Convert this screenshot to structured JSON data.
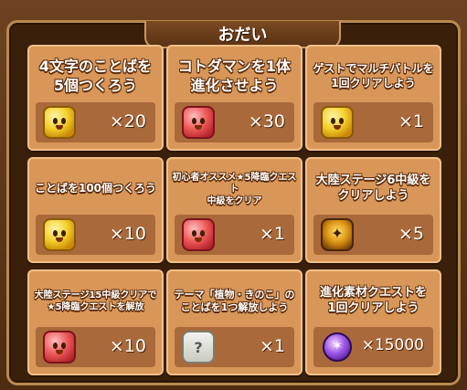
{
  "header": {
    "title": "おだい"
  },
  "quests": [
    {
      "title": "4文字のことばを\n5個つくろう",
      "reward_icon": "yellow-kotodaman-icon",
      "reward_qty": "×20"
    },
    {
      "title": "コトダマンを1体\n進化させよう",
      "reward_icon": "red-kotodaman-icon",
      "reward_qty": "×30"
    },
    {
      "title": "ゲストでマルチバトルを\n1回クリアしよう",
      "reward_icon": "yellow-kotodaman-icon",
      "reward_qty": "×1"
    },
    {
      "title": "ことばを100個つくろう",
      "reward_icon": "yellow-kotodaman-icon",
      "reward_qty": "×10"
    },
    {
      "title": "初心者オススメ★5降臨クエスト\n中級をクリア",
      "reward_icon": "red-kotodaman-icon",
      "reward_qty": "×1"
    },
    {
      "title": "大陸ステージ6中級を\nクリアしよう",
      "reward_icon": "gold-kotodaman-icon",
      "reward_qty": "×5"
    },
    {
      "title": "大陸ステージ15中級クリアで\n★5降臨クエストを解放",
      "reward_icon": "red-kotodaman-icon",
      "reward_qty": "×10"
    },
    {
      "title": "テーマ「植物・きのこ」の\nことばを1つ解放しよう",
      "reward_icon": "mystery-egg-icon",
      "reward_qty": "×1"
    },
    {
      "title": "進化素材クエストを\n1回クリアしよう",
      "reward_icon": "purple-orb-icon",
      "reward_qty": "×15000"
    }
  ],
  "colors": {
    "board": "#3a1f0b",
    "card": "#d89758",
    "card_border": "#f0c088",
    "reward_bar": "#a9693a"
  }
}
